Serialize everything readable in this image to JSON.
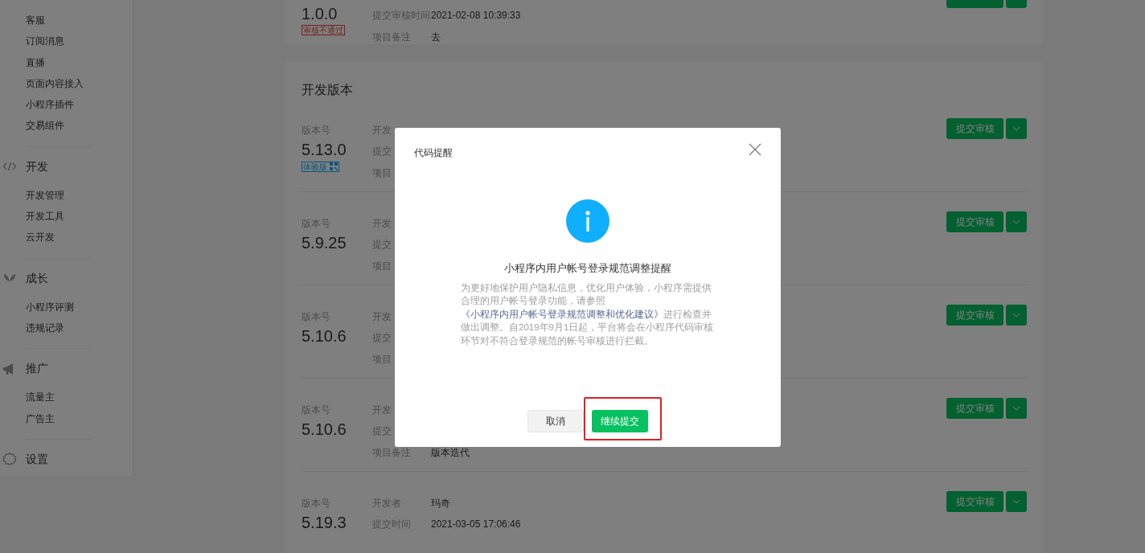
{
  "sidebar": {
    "groups": [
      {
        "items": [
          "客服",
          "订阅消息",
          "直播",
          "页面内容接入",
          "小程序插件",
          "交易组件"
        ]
      },
      {
        "title": "开发",
        "items": [
          "开发管理",
          "开发工具",
          "云开发"
        ]
      },
      {
        "title": "成长",
        "items": [
          "小程序评测",
          "违规记录"
        ]
      },
      {
        "title": "推广",
        "items": [
          "流量主",
          "广告主"
        ]
      },
      {
        "title": "设置"
      }
    ]
  },
  "review_version": {
    "version": "1.0.0",
    "badge": {
      "kind": "rejected",
      "text": "审核不通过"
    },
    "fields": [
      {
        "label": "提交审核时间",
        "value": "2021-02-08 10:39:33"
      },
      {
        "label": "项目备注",
        "value": "去"
      }
    ]
  },
  "dev_versions": {
    "title": "开发版本",
    "rows": [
      {
        "label": "版本号",
        "version": "5.13.0",
        "badge": {
          "kind": "trial",
          "text": "体验版"
        },
        "fields": [
          {
            "label": "开发"
          },
          {
            "label": "提交"
          },
          {
            "label": "项目"
          }
        ],
        "button": "提交审核"
      },
      {
        "label": "版本号",
        "version": "5.9.25",
        "fields": [
          {
            "label": "开发"
          },
          {
            "label": "提交"
          },
          {
            "label": "项目"
          }
        ],
        "button": "提交审核"
      },
      {
        "label": "版本号",
        "version": "5.10.6",
        "fields": [
          {
            "label": "开发"
          },
          {
            "label": "提交"
          },
          {
            "label": "项目"
          }
        ],
        "button": "提交审核"
      },
      {
        "label": "版本号",
        "version": "5.10.6",
        "fields": [
          {
            "label": "开发"
          },
          {
            "label": "提交"
          },
          {
            "label": "项目备注",
            "value": "版本迭代"
          }
        ],
        "button": "提交审核"
      },
      {
        "label": "版本号",
        "version": "5.19.3",
        "fields": [
          {
            "label": "开发者",
            "value": "玛奇"
          },
          {
            "label": "提交时间",
            "value": "2021-03-05 17:06:46"
          }
        ],
        "button": "提交审核"
      }
    ]
  },
  "modal": {
    "title": "代码提醒",
    "heading": "小程序内用户帐号登录规范调整提醒",
    "body_before": "为更好地保护用户隐私信息，优化用户体验，小程序需提供合理的用户帐号登录功能，请参照",
    "link": "《小程序内用户帐号登录规范调整和优化建议》",
    "body_after": "进行检查并做出调整。自2019年9月1日起，平台将会在小程序代码审核环节对不符合登录规范的帐号审核进行拦截。",
    "cancel": "取消",
    "confirm": "继续提交"
  }
}
